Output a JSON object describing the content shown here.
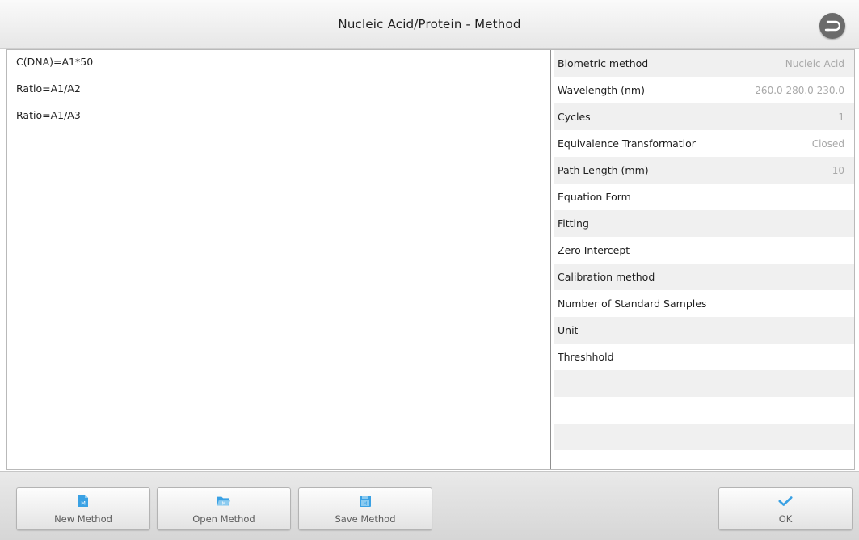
{
  "window": {
    "title": "Nucleic Acid/Protein - Method"
  },
  "formulas": [
    "C(DNA)=A1*50",
    "Ratio=A1/A2",
    "Ratio=A1/A3"
  ],
  "parameters": [
    {
      "label": "Biometric method",
      "value": "Nucleic Acid"
    },
    {
      "label": "Wavelength (nm)",
      "value": "260.0 280.0 230.0"
    },
    {
      "label": "Cycles",
      "value": "1"
    },
    {
      "label": "Equivalence Transformatior",
      "value": "Closed"
    },
    {
      "label": "Path Length (mm)",
      "value": "10"
    },
    {
      "label": "Equation Form",
      "value": ""
    },
    {
      "label": "Fitting",
      "value": ""
    },
    {
      "label": "Zero Intercept",
      "value": ""
    },
    {
      "label": "Calibration method",
      "value": ""
    },
    {
      "label": "Number of Standard Samples",
      "value": ""
    },
    {
      "label": "Unit",
      "value": ""
    },
    {
      "label": "Threshhold",
      "value": ""
    },
    {
      "label": "",
      "value": ""
    },
    {
      "label": "",
      "value": ""
    },
    {
      "label": "",
      "value": ""
    }
  ],
  "toolbar": {
    "new_label": "New Method",
    "open_label": "Open Method",
    "save_label": "Save Method",
    "ok_label": "OK",
    "icon_letter": "M"
  },
  "icons": {
    "back": "return-arrow-icon",
    "new": "new-file-icon",
    "open": "open-folder-icon",
    "save": "save-disk-icon",
    "ok": "checkmark-icon"
  },
  "colors": {
    "accent": "#3aa1e4",
    "accent_light": "#8ccbf0",
    "value_gray": "#a9a9a9",
    "back_button": "#6b6b6b"
  }
}
